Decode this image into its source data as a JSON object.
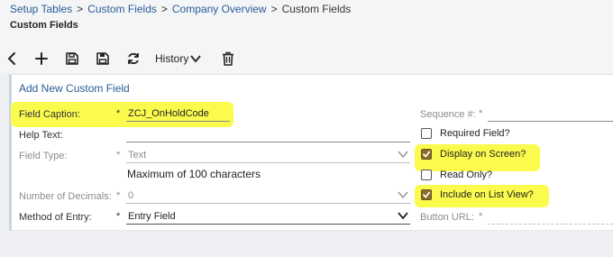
{
  "breadcrumb": {
    "items": [
      "Setup Tables",
      "Custom Fields",
      "Company Overview",
      "Custom Fields"
    ],
    "separator": ">"
  },
  "page": {
    "title": "Custom Fields"
  },
  "toolbar": {
    "back_icon": "chevron-left-icon",
    "add_icon": "plus-icon",
    "save_icon": "floppy-disk-icon",
    "save_close_icon": "floppy-disk-close-icon",
    "refresh_icon": "refresh-icon",
    "history_label": "History",
    "delete_icon": "trash-icon"
  },
  "form": {
    "title": "Add New Custom Field",
    "required_mark": "*",
    "field_caption": {
      "label": "Field Caption:",
      "value": "ZCJ_OnHoldCode"
    },
    "help_text": {
      "label": "Help Text:",
      "value": ""
    },
    "field_type": {
      "label": "Field Type:",
      "value": "Text",
      "hint": "Maximum of 100 characters"
    },
    "number_of_decimals": {
      "label": "Number of Decimals:",
      "value": "0"
    },
    "method_of_entry": {
      "label": "Method of Entry:",
      "value": "Entry Field"
    },
    "sequence": {
      "label": "Sequence #:",
      "value": ""
    },
    "checkboxes": [
      {
        "label": "Required Field?",
        "checked": false
      },
      {
        "label": "Display on Screen?",
        "checked": true
      },
      {
        "label": "Read Only?",
        "checked": false
      },
      {
        "label": "Include on List View?",
        "checked": true
      }
    ],
    "button_url": {
      "label": "Button URL:",
      "value": ""
    }
  },
  "colors": {
    "accent": "#2a5d95",
    "highlight": "#fbfb4e",
    "checkbox_checked": "#8a6b2a"
  }
}
